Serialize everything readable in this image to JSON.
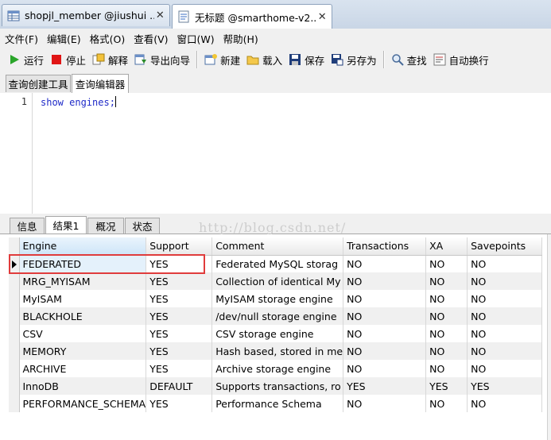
{
  "doc_tabs": [
    {
      "label": "shopjl_member @jiushui ...",
      "close": "✕"
    },
    {
      "label": "无标题 @smarthome-v2...",
      "close": "✕"
    }
  ],
  "menu": [
    "文件(F)",
    "编辑(E)",
    "格式(O)",
    "查看(V)",
    "窗口(W)",
    "帮助(H)"
  ],
  "toolbar": {
    "run": "运行",
    "stop": "停止",
    "explain": "解释",
    "export_wizard": "导出向导",
    "new": "新建",
    "load": "载入",
    "save": "保存",
    "save_as": "另存为",
    "find": "查找",
    "word_wrap": "自动换行"
  },
  "subtabs": [
    "查询创建工具",
    "查询编辑器"
  ],
  "editor": {
    "line_number": "1",
    "code": "show engines;"
  },
  "result_tabs": [
    "信息",
    "结果1",
    "概况",
    "状态"
  ],
  "watermark": "http://blog.csdn.net/",
  "grid": {
    "columns": [
      "Engine",
      "Support",
      "Comment",
      "Transactions",
      "XA",
      "Savepoints"
    ],
    "rows": [
      [
        "FEDERATED",
        "YES",
        "Federated MySQL storag",
        "NO",
        "NO",
        "NO"
      ],
      [
        "MRG_MYISAM",
        "YES",
        "Collection of identical My",
        "NO",
        "NO",
        "NO"
      ],
      [
        "MyISAM",
        "YES",
        "MyISAM storage engine",
        "NO",
        "NO",
        "NO"
      ],
      [
        "BLACKHOLE",
        "YES",
        "/dev/null storage engine",
        "NO",
        "NO",
        "NO"
      ],
      [
        "CSV",
        "YES",
        "CSV storage engine",
        "NO",
        "NO",
        "NO"
      ],
      [
        "MEMORY",
        "YES",
        "Hash based, stored in me",
        "NO",
        "NO",
        "NO"
      ],
      [
        "ARCHIVE",
        "YES",
        "Archive storage engine",
        "NO",
        "NO",
        "NO"
      ],
      [
        "InnoDB",
        "DEFAULT",
        "Supports transactions, ro",
        "YES",
        "YES",
        "YES"
      ],
      [
        "PERFORMANCE_SCHEMA",
        "YES",
        "Performance Schema",
        "NO",
        "NO",
        "NO"
      ]
    ]
  },
  "colors": {
    "highlight_box": "#e03c3c",
    "code_text": "#1f2ac8"
  }
}
